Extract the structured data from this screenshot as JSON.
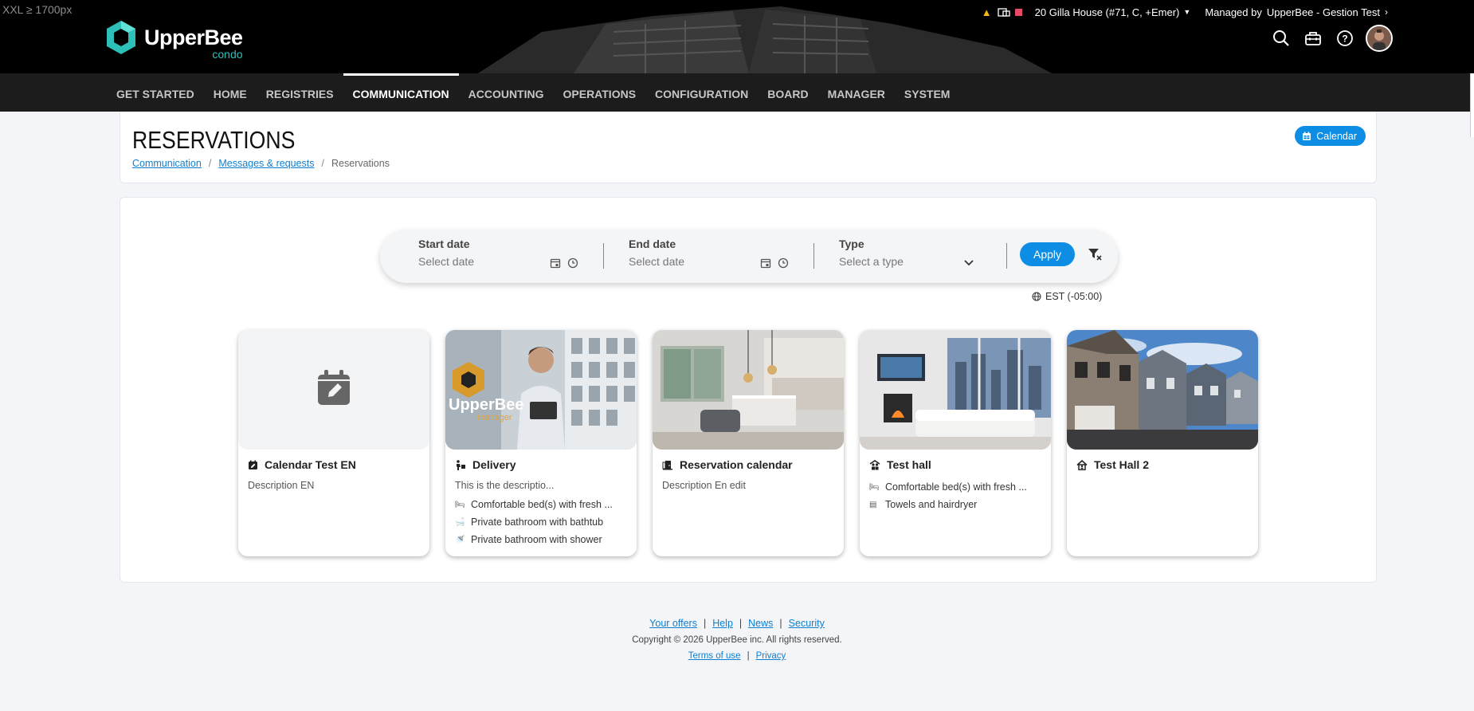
{
  "breakpoint_label": "XXL ≥ 1700px",
  "logo": {
    "main": "UpperBee",
    "sub": "condo"
  },
  "topbar": {
    "property": "20 Gilla House (#71, C, +Emer)",
    "managed_label": "Managed by",
    "manager": "UpperBee - Gestion Test"
  },
  "nav": {
    "items": [
      {
        "label": "GET STARTED"
      },
      {
        "label": "HOME"
      },
      {
        "label": "REGISTRIES"
      },
      {
        "label": "COMMUNICATION",
        "active": true
      },
      {
        "label": "ACCOUNTING"
      },
      {
        "label": "OPERATIONS"
      },
      {
        "label": "CONFIGURATION"
      },
      {
        "label": "BOARD"
      },
      {
        "label": "MANAGER"
      },
      {
        "label": "SYSTEM"
      }
    ]
  },
  "page": {
    "title": "RESERVATIONS",
    "calendar_button": "Calendar",
    "breadcrumb": [
      "Communication",
      "Messages & requests",
      "Reservations"
    ]
  },
  "filters": {
    "start_label": "Start date",
    "start_placeholder": "Select date",
    "end_label": "End date",
    "end_placeholder": "Select date",
    "type_label": "Type",
    "type_placeholder": "Select a type",
    "apply_label": "Apply",
    "timezone": "EST (-05:00)"
  },
  "cards": [
    {
      "title": "Calendar Test EN",
      "description": "Description EN",
      "features": []
    },
    {
      "title": "Delivery",
      "description": "This is the descriptio...",
      "features": [
        "Comfortable bed(s) with fresh ...",
        "Private bathroom with bathtub",
        "Private bathroom with shower"
      ],
      "image_logo": "UpperBee",
      "image_logo_sub": "manager"
    },
    {
      "title": "Reservation calendar",
      "description": "Description En edit",
      "features": []
    },
    {
      "title": "Test hall",
      "description": "",
      "features": [
        "Comfortable bed(s) with fresh ...",
        "Towels and hairdryer"
      ]
    },
    {
      "title": "Test Hall 2",
      "description": "",
      "features": []
    }
  ],
  "footer": {
    "links": [
      "Your offers",
      "Help",
      "News",
      "Security"
    ],
    "copyright": "Copyright © 2026 UpperBee inc. All rights reserved.",
    "legal": [
      "Terms of use",
      "Privacy"
    ]
  },
  "colors": {
    "accent": "#0d8de3",
    "brand_teal": "#2cc0b8",
    "nav_bg": "#1c1c1c"
  }
}
